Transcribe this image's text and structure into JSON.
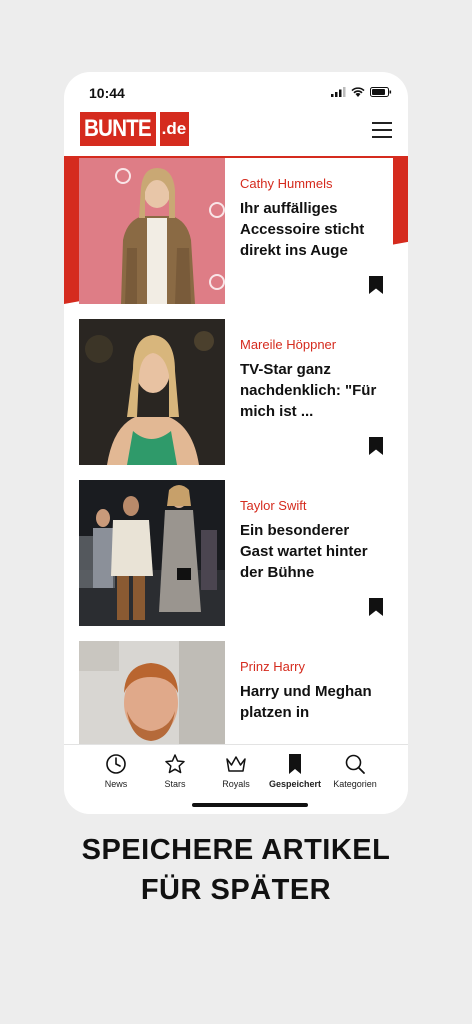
{
  "status_bar": {
    "time": "10:44"
  },
  "logo": {
    "brand": "BUNTE",
    "tld": ".de"
  },
  "articles": [
    {
      "kicker": "Cathy Hummels",
      "title": "Ihr auffälliges Accessoire sticht direkt ins Auge"
    },
    {
      "kicker": "Mareile Höppner",
      "title": "TV-Star ganz nachdenklich: \"Für mich ist ..."
    },
    {
      "kicker": "Taylor Swift",
      "title": "Ein besonderer Gast wartet hinter der Bühne"
    },
    {
      "kicker": "Prinz Harry",
      "title": "Harry und Meghan platzen in"
    }
  ],
  "tabs": [
    {
      "label": "News",
      "icon": "clock-icon"
    },
    {
      "label": "Stars",
      "icon": "star-icon"
    },
    {
      "label": "Royals",
      "icon": "crown-icon"
    },
    {
      "label": "Gespeichert",
      "icon": "bookmark-icon",
      "active": true
    },
    {
      "label": "Kategorien",
      "icon": "search-icon"
    }
  ],
  "tagline": {
    "line1": "SPEICHERE ARTIKEL",
    "line2": "FÜR SPÄTER"
  },
  "colors": {
    "brand_red": "#d52b1e",
    "background": "#ededed"
  }
}
